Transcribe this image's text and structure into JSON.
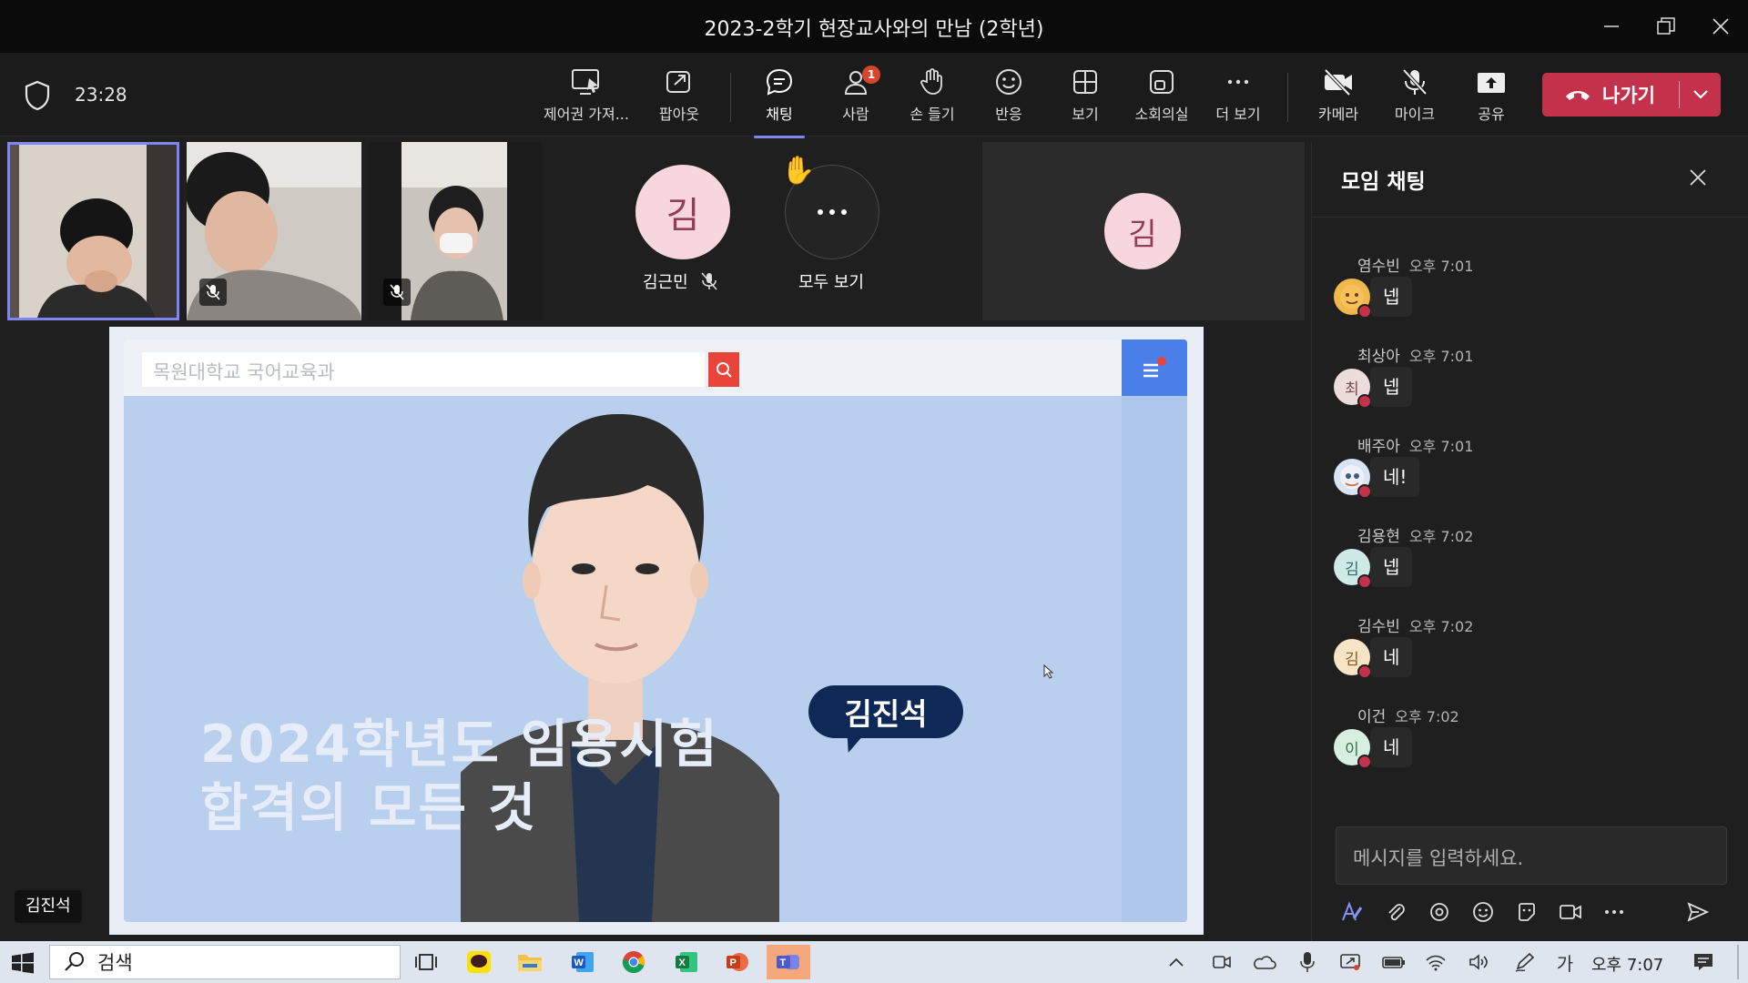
{
  "window": {
    "title": "2023-2학기 현장교사와의 만남 (2학년)"
  },
  "toolbar": {
    "timer": "23:28",
    "items": [
      {
        "label": "제어권 가져...",
        "icon": "request-control-icon"
      },
      {
        "label": "팝아웃",
        "icon": "popout-icon"
      },
      {
        "label": "채팅",
        "icon": "chat-icon"
      },
      {
        "label": "사람",
        "icon": "people-icon",
        "badge": "1"
      },
      {
        "label": "손 들기",
        "icon": "raise-hand-icon"
      },
      {
        "label": "반응",
        "icon": "react-icon"
      },
      {
        "label": "보기",
        "icon": "view-icon"
      },
      {
        "label": "소회의실",
        "icon": "breakout-rooms-icon"
      },
      {
        "label": "더 보기",
        "icon": "more-icon"
      },
      {
        "label": "카메라",
        "icon": "camera-off-icon"
      },
      {
        "label": "마이크",
        "icon": "mic-off-icon"
      },
      {
        "label": "공유",
        "icon": "share-icon"
      }
    ],
    "leave_label": "나가기",
    "accent": "#7f85f5",
    "leave_color": "#c4314b"
  },
  "participants": {
    "avatar_initial": "김",
    "kimgeunmin": {
      "name": "김근민",
      "initial": "김"
    },
    "view_all": "모두 보기",
    "raised_hand": "✋",
    "spotlight_initial": "김"
  },
  "slide": {
    "search_placeholder": "목원대학교 국어교육과",
    "headline_line1": "2024학년도 임용시험",
    "headline_line2": "합격의 모든 것",
    "speaker_name": "김진석",
    "presenter_tag": "김진석"
  },
  "chat": {
    "title": "모임 채팅",
    "messages": [
      {
        "sender": "염수빈",
        "time": "오후 7:01",
        "text": "넵",
        "initial": "",
        "avatar_color": "#f0b84a"
      },
      {
        "sender": "최상아",
        "time": "오후 7:01",
        "text": "넵",
        "initial": "최",
        "avatar_color": "#ecdcdc"
      },
      {
        "sender": "배주아",
        "time": "오후 7:01",
        "text": "네!",
        "initial": "",
        "avatar_color": "#d8e4f3"
      },
      {
        "sender": "김용현",
        "time": "오후 7:02",
        "text": "넵",
        "initial": "김",
        "avatar_color": "#cfe9e6"
      },
      {
        "sender": "김수빈",
        "time": "오후 7:02",
        "text": "네",
        "initial": "김",
        "avatar_color": "#f7e3c6"
      },
      {
        "sender": "이건",
        "time": "오후 7:02",
        "text": "네",
        "initial": "이",
        "avatar_color": "#d6efe0"
      }
    ],
    "composer_placeholder": "메시지를 입력하세요."
  },
  "taskbar": {
    "search_label": "검색",
    "ime": "가",
    "clock": "오후 7:07"
  }
}
